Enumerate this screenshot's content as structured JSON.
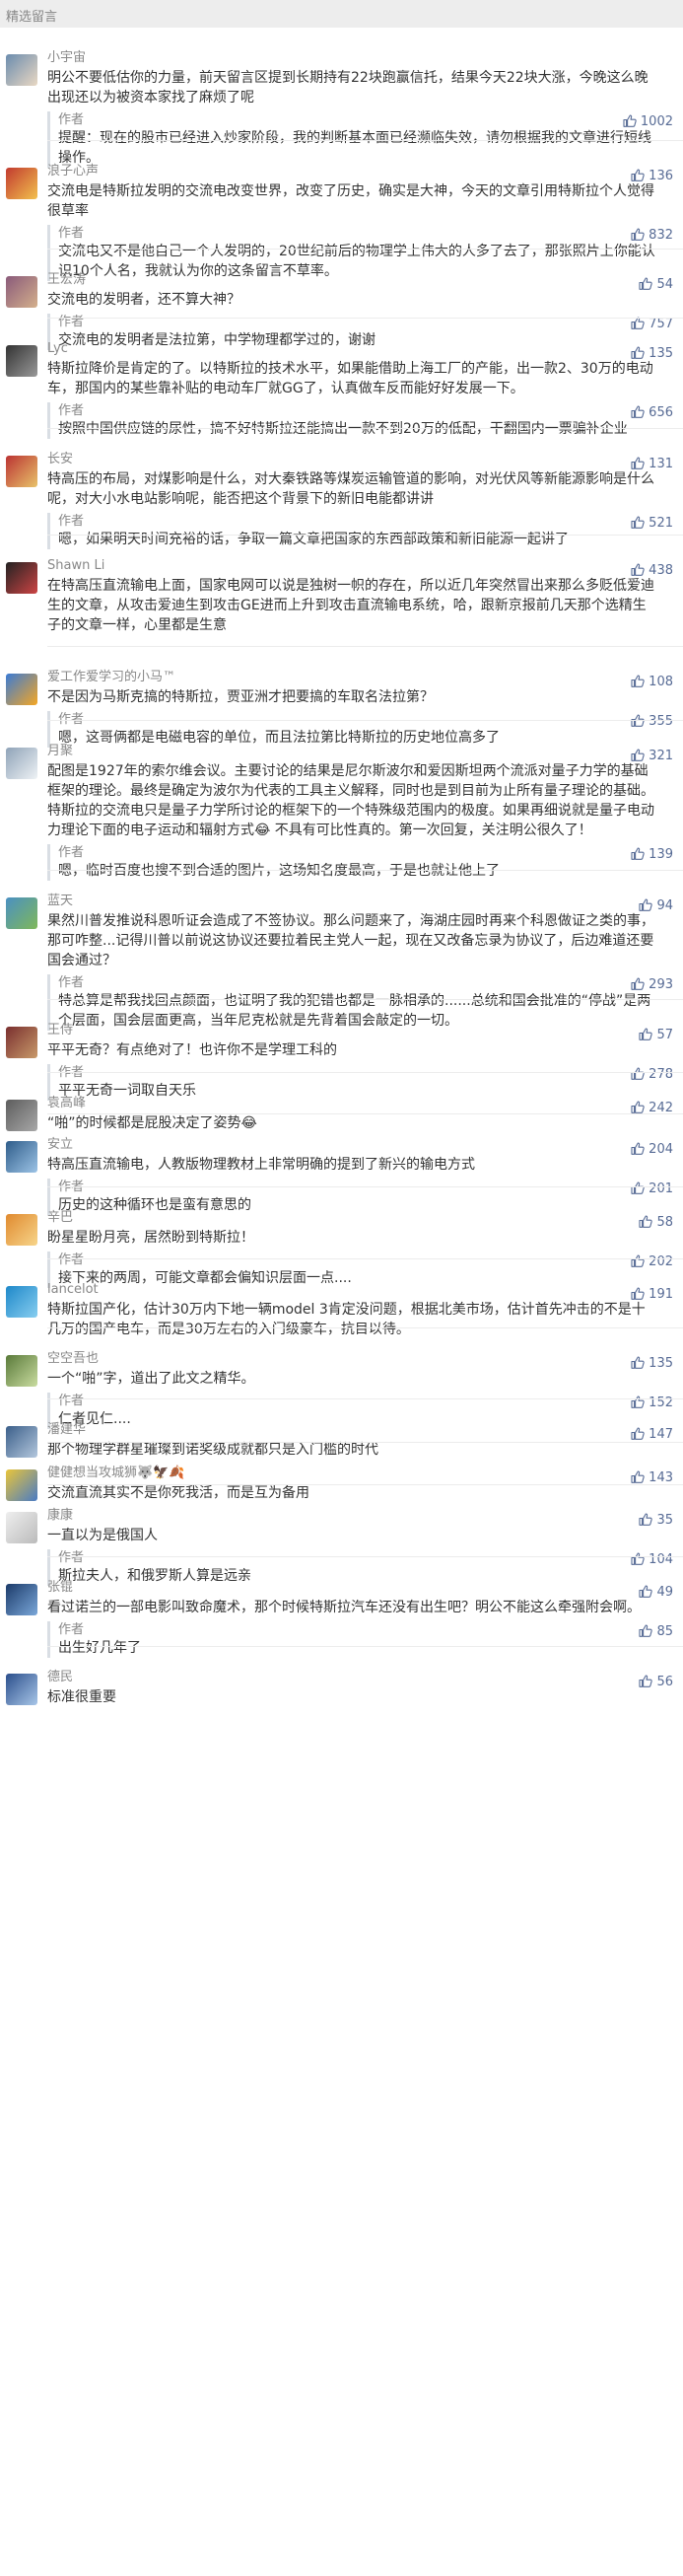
{
  "header": "精选留言",
  "comments": [
    {
      "n": "小宇宙",
      "t": "明公不要低估你的力量，前天留言区提到长期持有22块跑赢信托，结果今天22块大涨，今晚这么晚出现还以为被资本家找了麻烦了呢",
      "r": "提醒：现在的股市已经进入炒家阶段，我的判断基本面已经濒临失效，请勿根据我的文章进行短线操作。",
      "rl": "1002",
      "h": 115,
      "av": [
        "#6b8cae",
        "#e9d8c3"
      ]
    },
    {
      "n": "浪子心声",
      "l": "136",
      "t": "交流电是特斯拉发明的交流电改变世界，改变了历史，确实是大神，今天的文章引用特斯拉个人觉得很草率",
      "r": "交流电又不是他自己一个人发明的，20世纪前后的物理学上伟大的人多了去了，那张照片上你能认识10个人名，我就认为你的这条留言不草率。",
      "rl": "832",
      "h": 110,
      "av": [
        "#c23a2f",
        "#f2c14e"
      ]
    },
    {
      "n": "王宏涛",
      "l": "54",
      "t": "交流电的发明者，还不算大神？",
      "r": "交流电的发明者是法拉第，中学物理都学过的，谢谢",
      "rl": "757",
      "h": 70,
      "av": [
        "#8a5a7a",
        "#d4b08c"
      ]
    },
    {
      "n": "Lyc",
      "l": "135",
      "t": "特斯拉降价是肯定的了。以特斯拉的技术水平，如果能借助上海工厂的产能，出一款2、30万的电动车，那国内的某些靠补贴的电动车厂就GG了，认真做车反而能好好发展一下。",
      "r": "按照中国供应链的尿性，搞不好特斯拉还能搞出一款不到20万的低配，干翻国内一票骗补企业",
      "rl": "656",
      "h": 112,
      "av": [
        "#333",
        "#999"
      ]
    },
    {
      "n": "长安",
      "l": "131",
      "t": "特高压的布局，对煤影响是什么，对大秦铁路等煤炭运输管道的影响，对光伏风等新能源影响是什么呢，对大小水电站影响呢，能否把这个背景下的新旧电能都讲讲",
      "r": "嗯，如果明天时间充裕的话，争取一篇文章把国家的东西部政策和新旧能源一起讲了",
      "rl": "521",
      "h": 108,
      "av": [
        "#b33",
        "#e8c36a"
      ]
    },
    {
      "n": "Shawn Li",
      "l": "438",
      "t": "在特高压直流输电上面，国家电网可以说是独树一帜的存在，所以近几年突然冒出来那么多贬低爱迪生的文章，从攻击爱迪生到攻击GE进而上升到攻击直流输电系统，哈，跟新京报前几天那个选精生子的文章一样，心里都是生意",
      "h": 113,
      "av": [
        "#222",
        "#c44"
      ]
    },
    {
      "n": "爱工作爱学习的小马™",
      "l": "108",
      "t": "不是因为马斯克搞的特斯拉，贾亚洲才把要搞的车取名法拉第？",
      "r": "嗯，这哥俩都是电磁电容的单位，而且法拉第比特斯拉的历史地位高多了",
      "rl": "355",
      "h": 75,
      "av": [
        "#3a7bd5",
        "#f5a623"
      ]
    },
    {
      "n": "月聚",
      "l": "321",
      "t": "配图是1927年的索尔维会议。主要讨论的结果是尼尔斯波尔和爱因斯坦两个流派对量子力学的基础框架的理论。最终是确定为波尔为代表的工具主义解释，同时也是到目前为止所有量子理论的基础。特斯拉的交流电只是量子力学所讨论的框架下的一个特殊级范围内的极度。如果再细说就是量子电动力理论下面的电子运动和辐射方式😂 不具有可比性真的。第一次回复，关注明公很久了！",
      "r": "嗯，临时百度也搜不到合适的图片，这场知名度最高，于是也就让他上了",
      "rl": "139",
      "h": 152,
      "av": [
        "#8fa3b8",
        "#eef2f5"
      ]
    },
    {
      "n": "蓝天",
      "l": "94",
      "t": "果然川普发推说科恩听证会造成了不签协议。那么问题来了，海湖庄园时再来个科恩做证之类的事，那可咋整...记得川普以前说这协议还要拉着民主党人一起，现在又改备忘录为协议了，后边难道还要国会通过？",
      "r": "特总算是帮我找回点颜面，也证明了我的犯错也都是一脉相承的......总统和国会批准的“停战”是两个层面，国会层面更高，当年尼克松就是先背着国会敲定的一切。",
      "rl": "293",
      "h": 131,
      "av": [
        "#4a90c2",
        "#7fb85a"
      ]
    },
    {
      "n": "王侍",
      "l": "57",
      "t": "平平无奇？有点绝对了！也许你不是学理工科的",
      "r": "平平无奇一词取自天乐",
      "rl": "278",
      "h": 74,
      "av": [
        "#7a2f2f",
        "#c89a6a"
      ]
    },
    {
      "n": "袁高峰",
      "l": "242",
      "t": "“啪”的时候都是屁股决定了姿势😂",
      "h": 42,
      "av": [
        "#5d5d5d",
        "#a8a8a8"
      ]
    },
    {
      "n": "安立",
      "l": "204",
      "t": "特高压直流输电，人教版物理教材上非常明确的提到了新兴的输电方式",
      "r": "历史的这种循环也是蛮有意思的",
      "rl": "201",
      "h": 74,
      "av": [
        "#2f5d8a",
        "#9cc3e6"
      ]
    },
    {
      "n": "辛巴",
      "l": "58",
      "t": "盼星星盼月亮，居然盼到特斯拉！",
      "r": "接下来的两周，可能文章都会偏知识层面一点....",
      "rl": "202",
      "h": 73,
      "av": [
        "#e08a2f",
        "#f7d58a"
      ]
    },
    {
      "n": "lancelot",
      "l": "191",
      "t": "特斯拉国产化，估计30万内下地一辆model 3肯定没问题，根据北美市场，估计首先冲击的不是十几万的国产电车，而是30万左右的入门级豪车，抗目以待。",
      "h": 70,
      "av": [
        "#1e88c9",
        "#87cef0"
      ]
    },
    {
      "n": "空空吾也",
      "l": "135",
      "t": "一个“啪”字，道出了此文之精华。",
      "r": "仁者见仁....",
      "rl": "152",
      "h": 72,
      "av": [
        "#5a7a3a",
        "#c9dca0"
      ]
    },
    {
      "n": "潘建华",
      "l": "147",
      "t": "那个物理学群星璀璨到诺奖级成就都只是入门槛的时代",
      "h": 44,
      "av": [
        "#3b5f8a",
        "#b3c7dd"
      ]
    },
    {
      "n": "健健想当攻城狮🐺🦅🍂",
      "l": "143",
      "t": "交流直流其实不是你死我活，而是互为备用",
      "h": 43,
      "av": [
        "#e9c53a",
        "#4a7bc4"
      ]
    },
    {
      "n": "康康",
      "l": "35",
      "t": "一直以为是俄国人",
      "r": "斯拉夫人，和俄罗斯人算是远亲",
      "rl": "104",
      "h": 73,
      "av": [
        "#eee",
        "#bbb"
      ]
    },
    {
      "n": "张锟",
      "l": "49",
      "t": "看过诺兰的一部电影叫致命魔术，那个时候特斯拉汽车还没有出生吧？明公不能这么牵强附会啊。",
      "r": "出生好几年了",
      "rl": "85",
      "h": 91,
      "av": [
        "#1c3b6a",
        "#7aa7d9"
      ]
    },
    {
      "n": "德民",
      "l": "56",
      "t": "标准很重要",
      "h": 40,
      "av": [
        "#2b4f8c",
        "#a8c6e8"
      ]
    }
  ]
}
